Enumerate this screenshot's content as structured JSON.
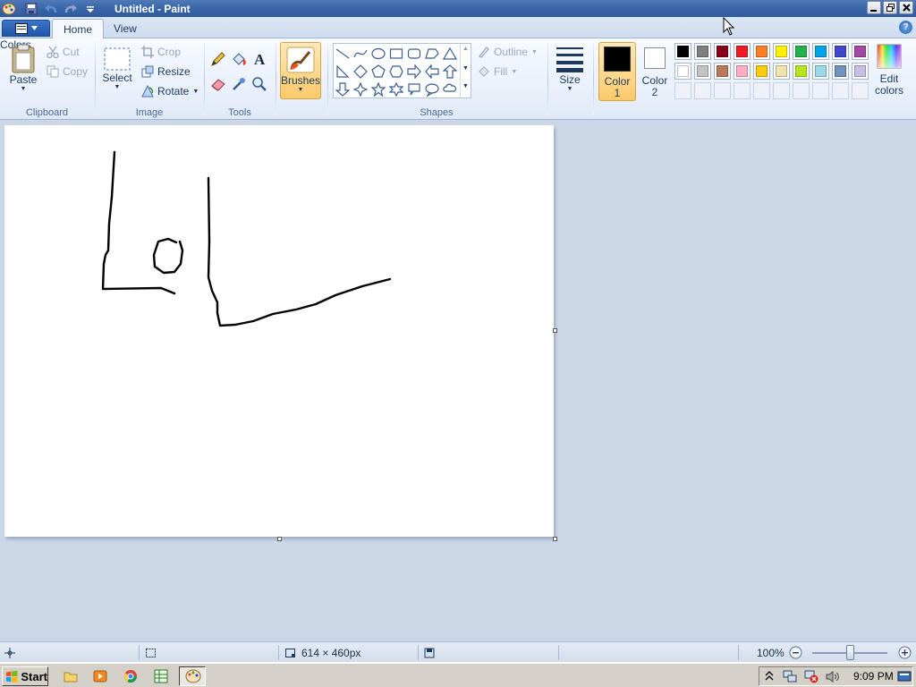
{
  "window": {
    "title": "Untitled - Paint"
  },
  "tabs": [
    {
      "label": "Home",
      "active": true
    },
    {
      "label": "View",
      "active": false
    }
  ],
  "ribbon": {
    "clipboard": {
      "label": "Clipboard",
      "paste": "Paste",
      "cut": "Cut",
      "copy": "Copy"
    },
    "image": {
      "label": "Image",
      "select": "Select",
      "crop": "Crop",
      "resize": "Resize",
      "rotate": "Rotate"
    },
    "tools": {
      "label": "Tools"
    },
    "brushes": {
      "label": "Brushes"
    },
    "shapes": {
      "label": "Shapes",
      "outline": "Outline",
      "fill": "Fill"
    },
    "size": {
      "label": "Size"
    },
    "colors": {
      "label": "Colors",
      "color1": "Color\n1",
      "color1_l1": "Color",
      "color1_l2": "1",
      "color2_l1": "Color",
      "color2_l2": "2",
      "edit_l1": "Edit",
      "edit_l2": "colors",
      "color1_value": "#000000",
      "color2_value": "#ffffff",
      "palette_row1": [
        "#000000",
        "#7f7f7f",
        "#880015",
        "#ed1c24",
        "#ff7f27",
        "#fff200",
        "#22b14c",
        "#00a2e8",
        "#3f48cc",
        "#a349a4"
      ],
      "palette_row2": [
        "#ffffff",
        "#c3c3c3",
        "#b97a57",
        "#ffaec9",
        "#ffc90e",
        "#efe4b0",
        "#b5e61d",
        "#99d9ea",
        "#7092be",
        "#c8bfe7"
      ]
    }
  },
  "status": {
    "canvas_size": "614 × 460px",
    "zoom": "100%",
    "zoom_fraction": 0.5
  },
  "taskbar": {
    "start": "Start",
    "clock": "9:09 PM"
  },
  "colors": {
    "accent_active": "#fbd27d",
    "title_blue": "#3a66a8"
  }
}
